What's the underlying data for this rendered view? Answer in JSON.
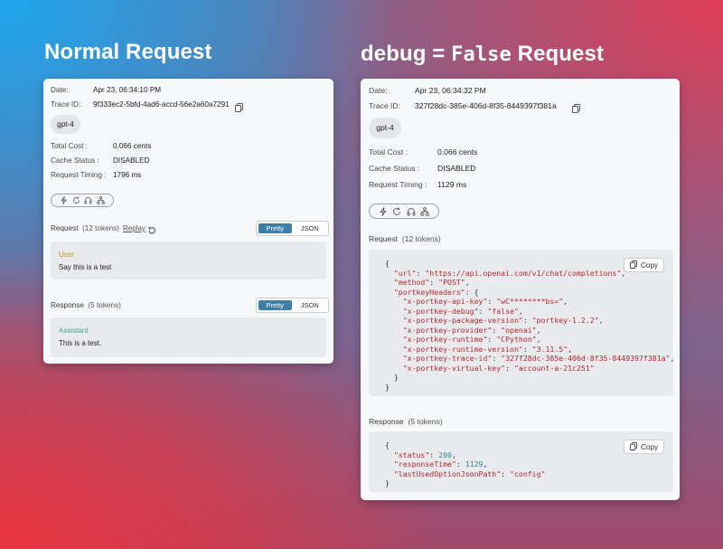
{
  "headings": {
    "left": "Normal Request",
    "right_prefix": "debug = ",
    "right_code": "False",
    "right_suffix": " Request"
  },
  "left_card": {
    "date_label": "Date:",
    "date_value": "Apr 23, 06:34:10 PM",
    "trace_label": "Trace ID:",
    "trace_value": "9f333ec2-5bfd-4ad6-accd-56e2a60a7291",
    "model": "gpt-4",
    "cost_label": "Total Cost :",
    "cost_value": "0.066 cents",
    "cache_label": "Cache Status :",
    "cache_value": "DISABLED",
    "timing_label": "Request Timing :",
    "timing_value": "1796 ms",
    "request_title": "Request",
    "request_tokens": "(12 tokens)",
    "replay": "Replay",
    "toggle_pretty": "Pretty",
    "toggle_json": "JSON",
    "user_role": "User",
    "user_message": "Say this is a test",
    "response_title": "Response",
    "response_tokens": "(5 tokens)",
    "assistant_role": "Assistant",
    "assistant_message": "This is a test."
  },
  "right_card": {
    "date_label": "Date:",
    "date_value": "Apr 23, 06:34:32 PM",
    "trace_label": "Trace ID:",
    "trace_value": "327f28dc-385e-406d-8f35-8449397f381a",
    "model": "gpt-4",
    "cost_label": "Total Cost :",
    "cost_value": "0.066 cents",
    "cache_label": "Cache Status :",
    "cache_value": "DISABLED",
    "timing_label": "Request Timing :",
    "timing_value": "1129 ms",
    "request_title": "Request",
    "request_tokens": "(12 tokens)",
    "copy": "Copy",
    "response_title": "Response",
    "response_tokens": "(5 tokens)",
    "request_json": [
      {
        "indent": 0,
        "parts": [
          [
            "p",
            "{"
          ]
        ]
      },
      {
        "indent": 1,
        "parts": [
          [
            "k",
            "\"url\""
          ],
          [
            "p",
            ": "
          ],
          [
            "s",
            "\"https://api.openai.com/v1/chat/completions\""
          ],
          [
            "p",
            ","
          ]
        ]
      },
      {
        "indent": 1,
        "parts": [
          [
            "k",
            "\"method\""
          ],
          [
            "p",
            ": "
          ],
          [
            "s",
            "\"POST\""
          ],
          [
            "p",
            ","
          ]
        ]
      },
      {
        "indent": 1,
        "parts": [
          [
            "k",
            "\"portkeyHeaders\""
          ],
          [
            "p",
            ": {"
          ]
        ]
      },
      {
        "indent": 2,
        "parts": [
          [
            "k",
            "\"x-portkey-api-key\""
          ],
          [
            "p",
            ": "
          ],
          [
            "s",
            "\"wC********bs=\""
          ],
          [
            "p",
            ","
          ]
        ]
      },
      {
        "indent": 2,
        "parts": [
          [
            "k",
            "\"x-portkey-debug\""
          ],
          [
            "p",
            ": "
          ],
          [
            "s",
            "\"false\""
          ],
          [
            "p",
            ","
          ]
        ]
      },
      {
        "indent": 2,
        "parts": [
          [
            "k",
            "\"x-portkey-package-version\""
          ],
          [
            "p",
            ": "
          ],
          [
            "s",
            "\"portkey-1.2.2\""
          ],
          [
            "p",
            ","
          ]
        ]
      },
      {
        "indent": 2,
        "parts": [
          [
            "k",
            "\"x-portkey-provider\""
          ],
          [
            "p",
            ": "
          ],
          [
            "s",
            "\"openai\""
          ],
          [
            "p",
            ","
          ]
        ]
      },
      {
        "indent": 2,
        "parts": [
          [
            "k",
            "\"x-portkey-runtime\""
          ],
          [
            "p",
            ": "
          ],
          [
            "s",
            "\"CPython\""
          ],
          [
            "p",
            ","
          ]
        ]
      },
      {
        "indent": 2,
        "parts": [
          [
            "k",
            "\"x-portkey-runtime-version\""
          ],
          [
            "p",
            ": "
          ],
          [
            "s",
            "\"3.11.5\""
          ],
          [
            "p",
            ","
          ]
        ]
      },
      {
        "indent": 2,
        "parts": [
          [
            "k",
            "\"x-portkey-trace-id\""
          ],
          [
            "p",
            ": "
          ],
          [
            "s",
            "\"327f28dc-385e-406d-8f35-8449397f381a\""
          ],
          [
            "p",
            ","
          ]
        ]
      },
      {
        "indent": 2,
        "parts": [
          [
            "k",
            "\"x-portkey-virtual-key\""
          ],
          [
            "p",
            ": "
          ],
          [
            "s",
            "\"account-a-21c251\""
          ]
        ]
      },
      {
        "indent": 1,
        "parts": [
          [
            "p",
            "}"
          ]
        ]
      },
      {
        "indent": 0,
        "parts": [
          [
            "p",
            "}"
          ]
        ]
      }
    ],
    "response_json": [
      {
        "indent": 0,
        "parts": [
          [
            "p",
            "{"
          ]
        ]
      },
      {
        "indent": 1,
        "parts": [
          [
            "k",
            "\"status\""
          ],
          [
            "p",
            ": "
          ],
          [
            "n",
            "200"
          ],
          [
            "p",
            ","
          ]
        ]
      },
      {
        "indent": 1,
        "parts": [
          [
            "k",
            "\"responseTime\""
          ],
          [
            "p",
            ": "
          ],
          [
            "n",
            "1129"
          ],
          [
            "p",
            ","
          ]
        ]
      },
      {
        "indent": 1,
        "parts": [
          [
            "k",
            "\"lastUsedOptionJsonPath\""
          ],
          [
            "p",
            ": "
          ],
          [
            "s",
            "\"config\""
          ]
        ]
      },
      {
        "indent": 0,
        "parts": [
          [
            "p",
            "}"
          ]
        ]
      }
    ]
  },
  "colors": {
    "toggle_active": "#3d7fa6",
    "user_role": "#c9962b",
    "assistant_role": "#3aa690",
    "json_key": "#b3282d",
    "json_number": "#2d8a8a"
  },
  "icons": [
    "bolt-icon",
    "refresh-icon",
    "headphones-icon",
    "hierarchy-icon",
    "copy-icon",
    "replay-icon"
  ]
}
